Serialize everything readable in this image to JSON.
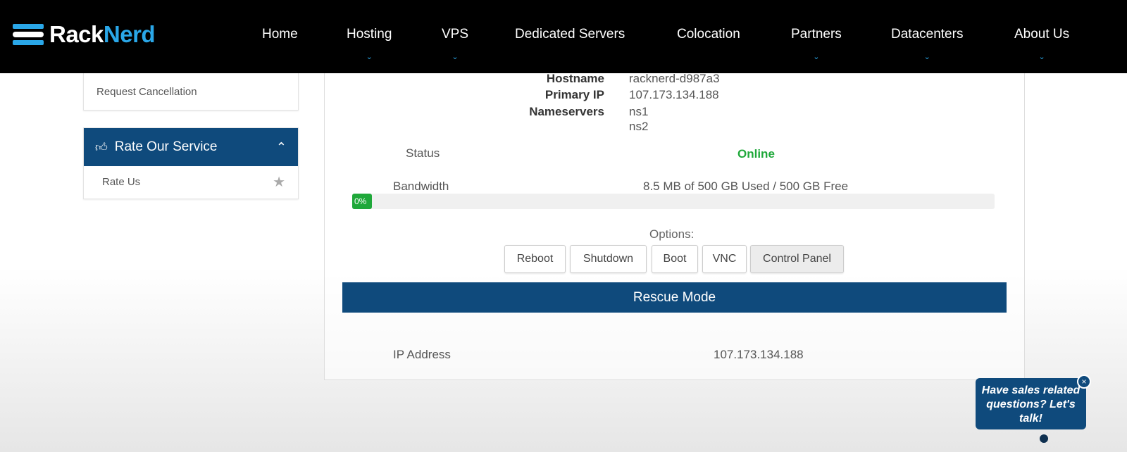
{
  "brand": {
    "part1": "Rack",
    "part2": "Nerd"
  },
  "nav": [
    {
      "label": "Home",
      "dropdown": false
    },
    {
      "label": "Hosting",
      "dropdown": true
    },
    {
      "label": "VPS",
      "dropdown": true
    },
    {
      "label": "Dedicated Servers",
      "dropdown": false
    },
    {
      "label": "Colocation",
      "dropdown": false
    },
    {
      "label": "Partners",
      "dropdown": true
    },
    {
      "label": "Datacenters",
      "dropdown": true
    },
    {
      "label": "About Us",
      "dropdown": true
    }
  ],
  "sidebar": {
    "request_cancellation": "Request Cancellation",
    "rate_header": "Rate Our Service",
    "rate_us": "Rate Us"
  },
  "server": {
    "hostname_label": "Hostname",
    "hostname": "racknerd-d987a3",
    "primary_ip_label": "Primary IP",
    "primary_ip": "107.173.134.188",
    "nameservers_label": "Nameservers",
    "ns1": "ns1",
    "ns2": "ns2",
    "status_label": "Status",
    "status": "Online",
    "bandwidth_label": "Bandwidth",
    "bandwidth": "8.5 MB of 500 GB Used / 500 GB Free",
    "bandwidth_percent": "0%",
    "options_label": "Options:",
    "buttons": {
      "reboot": "Reboot",
      "shutdown": "Shutdown",
      "boot": "Boot",
      "vnc": "VNC",
      "control_panel": "Control Panel"
    },
    "rescue_mode": "Rescue Mode",
    "ip_address_label": "IP Address",
    "ip_address": "107.173.134.188"
  },
  "chat": {
    "text": "Have sales related questions? Let's talk!",
    "close": "×"
  },
  "colors": {
    "brand_blue": "#2aa7e8",
    "navy": "#0f4a7c",
    "online_green": "#1fa83a"
  }
}
